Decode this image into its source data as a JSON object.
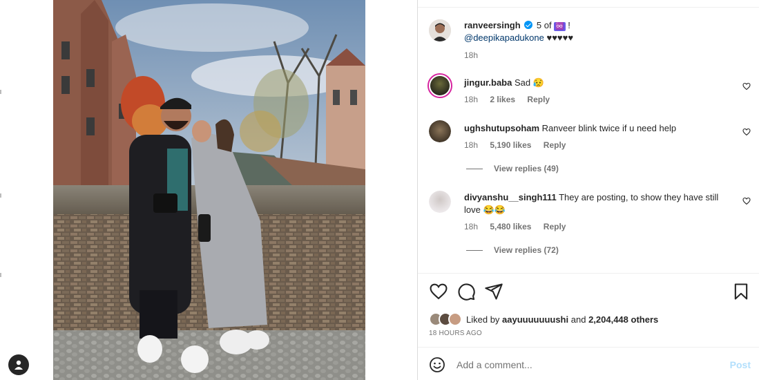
{
  "caption": {
    "username": "ranveersingh",
    "text_a": "5 of",
    "badge": "♾️",
    "text_b": "!",
    "mention": "@deepikapadukone",
    "hearts": "♥♥♥♥♥",
    "time": "18h"
  },
  "comments": [
    {
      "username": "jingur.baba",
      "text": "Sad 😥",
      "time": "18h",
      "likes": "2 likes",
      "reply": "Reply"
    },
    {
      "username": "ughshutupsoham",
      "text": "Ranveer blink twice if u need help",
      "time": "18h",
      "likes": "5,190 likes",
      "reply": "Reply",
      "view_replies": "View replies (49)"
    },
    {
      "username": "divyanshu__singh111",
      "text": "They are posting, to show they have still love 😂😂",
      "time": "18h",
      "likes": "5,480 likes",
      "reply": "Reply",
      "view_replies": "View replies (72)"
    }
  ],
  "likes_line": {
    "prefix": "Liked by",
    "user": "aayuuuuuuushi",
    "mid": "and",
    "count": "2,204,448 others"
  },
  "timestamp": "18 HOURS AGO",
  "comment_input": {
    "placeholder": "Add a comment...",
    "post_label": "Post"
  },
  "colors": {
    "link": "#00376b",
    "verified": "#0095f6",
    "post_disabled": "#b2dffc"
  },
  "icons": [
    "heart-icon",
    "comment-icon",
    "share-icon",
    "bookmark-icon",
    "emoji-icon",
    "user-icon"
  ]
}
